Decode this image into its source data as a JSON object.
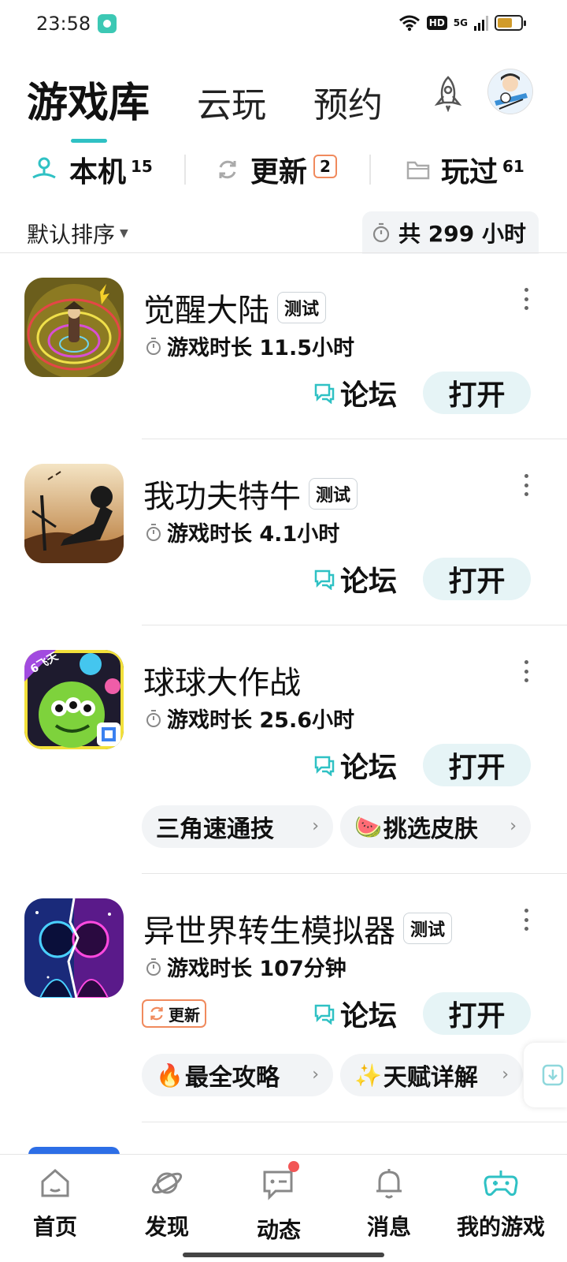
{
  "status_bar": {
    "time": "23:58",
    "hd": "HD",
    "network": "5G"
  },
  "top_tabs": [
    {
      "label": "游戏库",
      "active": true
    },
    {
      "label": "云玩",
      "active": false
    },
    {
      "label": "预约",
      "active": false
    }
  ],
  "filters": {
    "local": {
      "label": "本机",
      "count": "15"
    },
    "update": {
      "label": "更新",
      "count": "2"
    },
    "played": {
      "label": "玩过",
      "count": "61"
    }
  },
  "sort": {
    "label": "默认排序",
    "total_playtime": "共 299 小时"
  },
  "games": [
    {
      "title": "觉醒大陆",
      "badge": "测试",
      "playtime": "游戏时长 11.5小时",
      "forum": "论坛",
      "open": "打开"
    },
    {
      "title": "我功夫特牛",
      "badge": "测试",
      "playtime": "游戏时长 4.1小时",
      "forum": "论坛",
      "open": "打开"
    },
    {
      "title": "球球大作战",
      "badge": "",
      "playtime": "游戏时长 25.6小时",
      "forum": "论坛",
      "open": "打开",
      "icon_ribbon": "6飞天",
      "chips": [
        {
          "emoji": "",
          "label": "三角速通技"
        },
        {
          "emoji": "🍉",
          "label": "挑选皮肤"
        }
      ]
    },
    {
      "title": "异世界转生模拟器",
      "badge": "测试",
      "playtime": "游戏时长 107分钟",
      "forum": "论坛",
      "open": "打开",
      "update_label": "更新",
      "chips": [
        {
          "emoji": "🔥",
          "label": "最全攻略"
        },
        {
          "emoji": "✨",
          "label": "天赋详解"
        }
      ]
    }
  ],
  "bottom_nav": [
    {
      "label": "首页",
      "icon": "home-icon",
      "active": false
    },
    {
      "label": "发现",
      "icon": "planet-icon",
      "active": false
    },
    {
      "label": "动态",
      "icon": "chat-icon",
      "active": false,
      "dot": true
    },
    {
      "label": "消息",
      "icon": "bell-icon",
      "active": false
    },
    {
      "label": "我的游戏",
      "icon": "gamepad-icon",
      "active": true
    }
  ],
  "colors": {
    "accent": "#2fc1c4",
    "open_button_bg": "#e6f4f6",
    "update_border": "#f08a5d",
    "notification_dot": "#f25656",
    "chip_bg": "#f2f4f6"
  }
}
